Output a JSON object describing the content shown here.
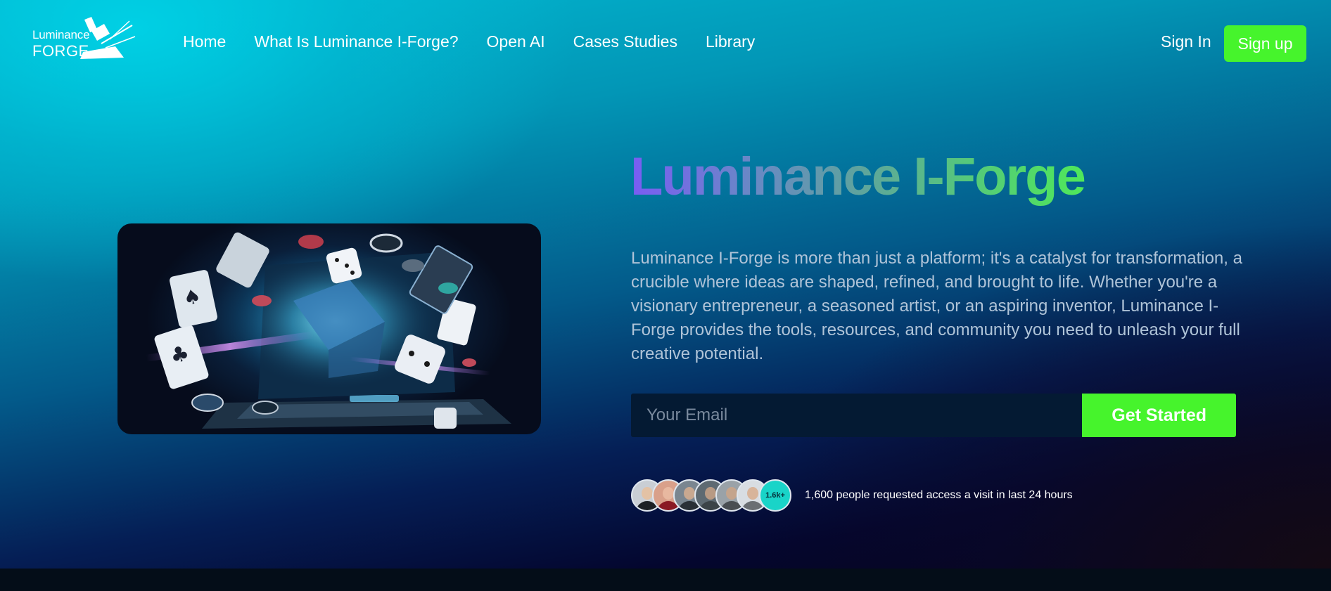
{
  "logo": {
    "line1": "Luminance",
    "line2": "FORGE"
  },
  "nav": {
    "items": [
      {
        "label": "Home"
      },
      {
        "label": "What Is Luminance I-Forge?"
      },
      {
        "label": "Open AI"
      },
      {
        "label": "Cases Studies"
      },
      {
        "label": "Library"
      }
    ]
  },
  "header": {
    "signin_label": "Sign In",
    "signup_label": "Sign up"
  },
  "hero": {
    "title": "Luminance I-Forge",
    "description": "Luminance I-Forge is more than just a platform; it's a catalyst for transformation, a crucible where ideas are shaped, refined, and brought to life. Whether you're a visionary entrepreneur, a seasoned artist, or an aspiring inventor, Luminance I-Forge provides the tools, resources, and community you need to unleash your full creative potential.",
    "image_icon": "casino-laptop-illustration",
    "email_placeholder": "Your Email",
    "cta_label": "Get Started",
    "count_badge": "1.6k+",
    "social_proof": "1,600 people requested access a visit in last 24 hours"
  },
  "colors": {
    "accent_green": "#46f42c",
    "title_gradient_start": "#7a5cf4",
    "title_gradient_end": "#4fe85a",
    "badge_teal": "#19d4c8"
  }
}
